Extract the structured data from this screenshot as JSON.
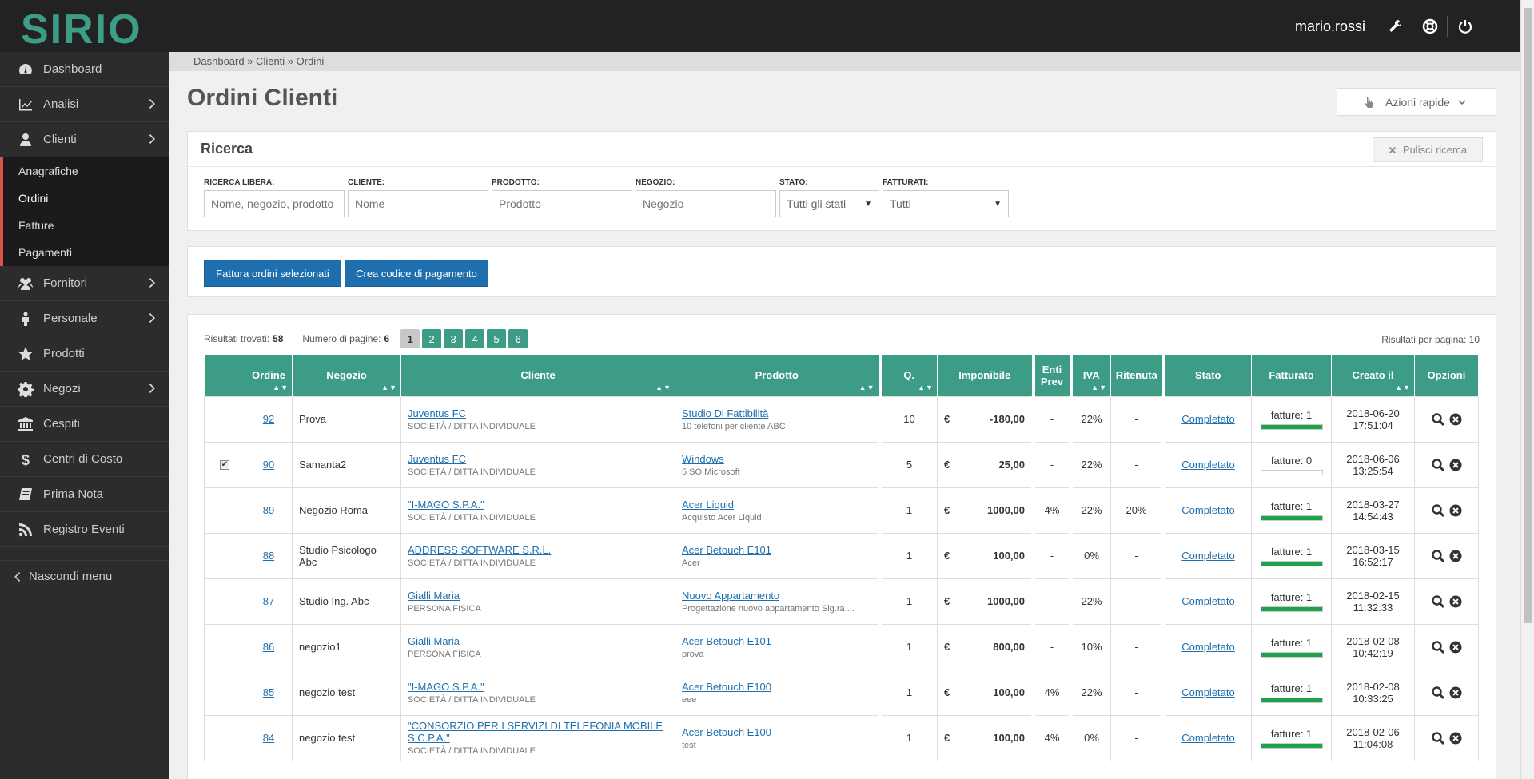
{
  "app": {
    "logo_text": "SIRIO",
    "user_name": "mario.rossi"
  },
  "sidebar": {
    "items": [
      {
        "label": "Dashboard",
        "icon": "dashboard-icon",
        "has_children": false
      },
      {
        "label": "Analisi",
        "icon": "chart-line-icon",
        "has_children": true
      },
      {
        "label": "Clienti",
        "icon": "user-icon",
        "has_children": true
      }
    ],
    "clienti_sub": [
      "Anagrafiche",
      "Ordini",
      "Fatture",
      "Pagamenti"
    ],
    "items_after": [
      {
        "label": "Fornitori",
        "icon": "users-icon",
        "has_children": true
      },
      {
        "label": "Personale",
        "icon": "person-icon",
        "has_children": true
      },
      {
        "label": "Prodotti",
        "icon": "star-icon",
        "has_children": false
      },
      {
        "label": "Negozi",
        "icon": "gear-icon",
        "has_children": true
      },
      {
        "label": "Cespiti",
        "icon": "bank-icon",
        "has_children": false
      },
      {
        "label": "Centri di Costo",
        "icon": "dollar-icon",
        "has_children": false
      },
      {
        "label": "Prima Nota",
        "icon": "book-icon",
        "has_children": false
      },
      {
        "label": "Registro Eventi",
        "icon": "rss-icon",
        "has_children": false
      }
    ],
    "hide_menu": "Nascondi menu"
  },
  "breadcrumb": "Dashboard » Clienti » Ordini",
  "page": {
    "title": "Ordini Clienti",
    "quick_actions": "Azioni rapide"
  },
  "search": {
    "title": "Ricerca",
    "clear": "Pulisci ricerca",
    "fields": {
      "free": {
        "label": "Ricerca libera:",
        "placeholder": "Nome, negozio, prodotto"
      },
      "client": {
        "label": "Cliente:",
        "placeholder": "Nome"
      },
      "product": {
        "label": "Prodotto:",
        "placeholder": "Prodotto"
      },
      "shop": {
        "label": "Negozio:",
        "placeholder": "Negozio"
      },
      "status": {
        "label": "Stato:",
        "value": "Tutti gli stati"
      },
      "billed": {
        "label": "Fatturati:",
        "value": "Tutti"
      }
    }
  },
  "actions": {
    "invoice": "Fattura ordini selezionati",
    "paycode": "Crea codice di pagamento"
  },
  "results": {
    "found_label": "Risultati trovati:",
    "found": "58",
    "pages_label": "Numero di pagine:",
    "pages": "6",
    "page_numbers": [
      "1",
      "2",
      "3",
      "4",
      "5",
      "6"
    ],
    "per_page": "Risultati per pagina: 10"
  },
  "table": {
    "headers": {
      "ordine": "Ordine",
      "negozio": "Negozio",
      "cliente": "Cliente",
      "prodotto": "Prodotto",
      "q": "Q.",
      "imponibile": "Imponibile",
      "enti": "Enti Prev",
      "iva": "IVA",
      "ritenuta": "Ritenuta",
      "stato": "Stato",
      "fatturato": "Fatturato",
      "creato": "Creato il",
      "opzioni": "Opzioni"
    },
    "currency": "€",
    "rows": [
      {
        "checked": false,
        "order": "92",
        "shop": "Prova",
        "client": "Juventus FC",
        "client_type": "SOCIETÀ / DITTA INDIVIDUALE",
        "product": "Studio Di Fattibilità",
        "product_desc": "10 telefoni per cliente ABC",
        "qty": "10",
        "amount": "-180,00",
        "enti": "-",
        "iva": "22%",
        "rit": "-",
        "status": "Completato",
        "invoices": "fatture: 1",
        "billed_fraction": 1,
        "date": "2018-06-20",
        "time": "17:51:04"
      },
      {
        "checked": true,
        "order": "90",
        "shop": "Samanta2",
        "client": "Juventus FC",
        "client_type": "SOCIETÀ / DITTA INDIVIDUALE",
        "product": "Windows",
        "product_desc": "5 SO Microsoft",
        "qty": "5",
        "amount": "25,00",
        "enti": "-",
        "iva": "22%",
        "rit": "-",
        "status": "Completato",
        "invoices": "fatture: 0",
        "billed_fraction": 0,
        "date": "2018-06-06",
        "time": "13:25:54"
      },
      {
        "checked": false,
        "order": "89",
        "shop": "Negozio Roma",
        "client": "\"I-MAGO S.P.A.\"",
        "client_type": "SOCIETÀ / DITTA INDIVIDUALE",
        "product": "Acer Liquid",
        "product_desc": "Acquisto Acer Liquid",
        "qty": "1",
        "amount": "1000,00",
        "enti": "4%",
        "iva": "22%",
        "rit": "20%",
        "status": "Completato",
        "invoices": "fatture: 1",
        "billed_fraction": 1,
        "date": "2018-03-27",
        "time": "14:54:43"
      },
      {
        "checked": false,
        "order": "88",
        "shop": "Studio Psicologo Abc",
        "client": "ADDRESS SOFTWARE S.R.L.",
        "client_type": "SOCIETÀ / DITTA INDIVIDUALE",
        "product": "Acer Betouch E101",
        "product_desc": "Acer",
        "qty": "1",
        "amount": "100,00",
        "enti": "-",
        "iva": "0%",
        "rit": "-",
        "status": "Completato",
        "invoices": "fatture: 1",
        "billed_fraction": 1,
        "date": "2018-03-15",
        "time": "16:52:17"
      },
      {
        "checked": false,
        "order": "87",
        "shop": "Studio Ing. Abc",
        "client": "Gialli Maria",
        "client_type": "PERSONA FISICA",
        "product": "Nuovo Appartamento",
        "product_desc": "Progettazione nuovo appartamento Sig.ra ...",
        "qty": "1",
        "amount": "1000,00",
        "enti": "-",
        "iva": "22%",
        "rit": "-",
        "status": "Completato",
        "invoices": "fatture: 1",
        "billed_fraction": 1,
        "date": "2018-02-15",
        "time": "11:32:33"
      },
      {
        "checked": false,
        "order": "86",
        "shop": "negozio1",
        "client": "Gialli Maria",
        "client_type": "PERSONA FISICA",
        "product": "Acer Betouch E101",
        "product_desc": "prova",
        "qty": "1",
        "amount": "800,00",
        "enti": "-",
        "iva": "10%",
        "rit": "-",
        "status": "Completato",
        "invoices": "fatture: 1",
        "billed_fraction": 1,
        "date": "2018-02-08",
        "time": "10:42:19"
      },
      {
        "checked": false,
        "order": "85",
        "shop": "negozio test",
        "client": "\"I-MAGO S.P.A.\"",
        "client_type": "SOCIETÀ / DITTA INDIVIDUALE",
        "product": "Acer Betouch E100",
        "product_desc": "eee",
        "qty": "1",
        "amount": "100,00",
        "enti": "4%",
        "iva": "22%",
        "rit": "-",
        "status": "Completato",
        "invoices": "fatture: 1",
        "billed_fraction": 1,
        "date": "2018-02-08",
        "time": "10:33:25"
      },
      {
        "checked": false,
        "order": "84",
        "shop": "negozio test",
        "client": "\"CONSORZIO PER I SERVIZI DI TELEFONIA MOBILE S.C.P.A.\"",
        "client_type": "SOCIETÀ / DITTA INDIVIDUALE",
        "product": "Acer Betouch E100",
        "product_desc": "test",
        "qty": "1",
        "amount": "100,00",
        "enti": "4%",
        "iva": "0%",
        "rit": "-",
        "status": "Completato",
        "invoices": "fatture: 1",
        "billed_fraction": 1,
        "date": "2018-02-06",
        "time": "11:04:08"
      }
    ]
  }
}
